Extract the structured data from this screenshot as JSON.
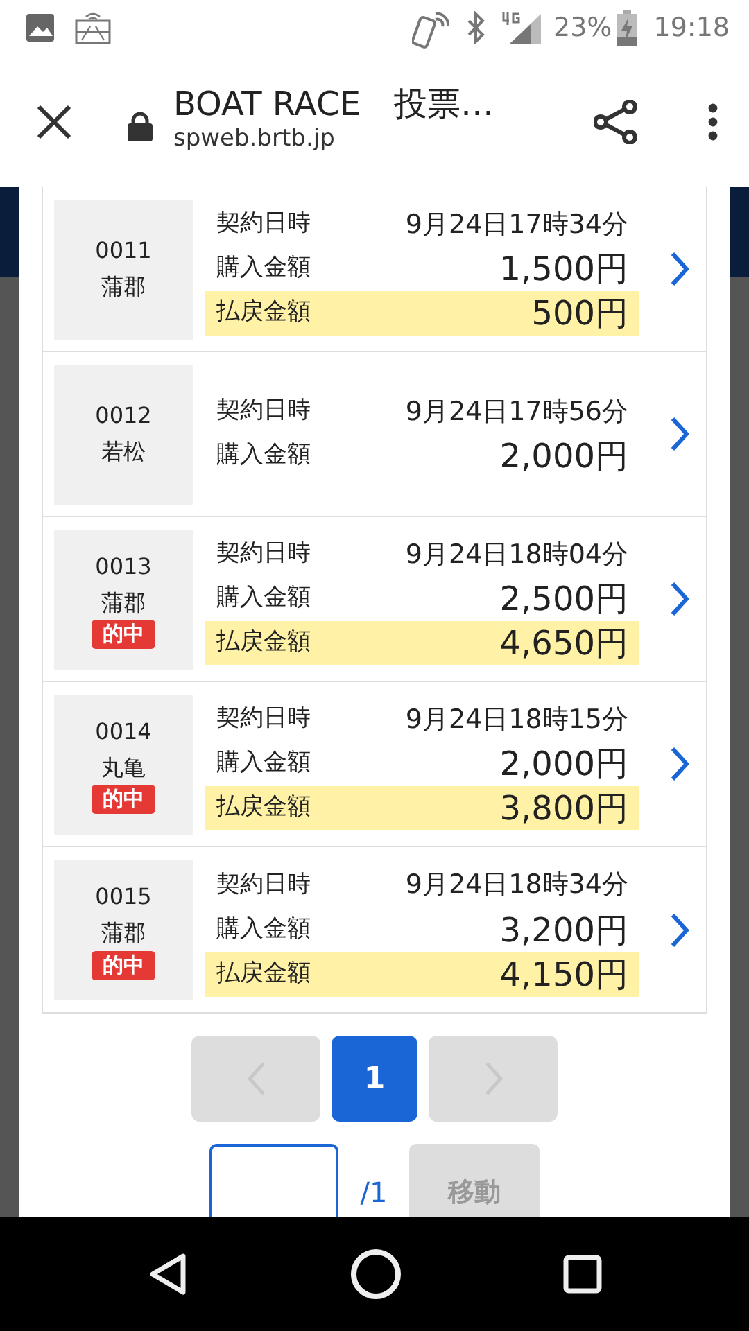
{
  "status_bar": {
    "battery": "23%",
    "time": "19:18"
  },
  "browser": {
    "title": "BOAT RACE　投票…",
    "url": "spweb.brtb.jp"
  },
  "tickets": [
    {
      "number": "0011",
      "venue": "蒲郡",
      "rows": [
        {
          "kind": "plain",
          "label": "契約日時",
          "value": "9月24日17時34分"
        },
        {
          "kind": "amount",
          "label": "購入金額",
          "value": "1,500円"
        },
        {
          "kind": "payout",
          "label": "払戻金額",
          "value": "500円"
        }
      ]
    },
    {
      "number": "0012",
      "venue": "若松",
      "rows": [
        {
          "kind": "plain",
          "label": "契約日時",
          "value": "9月24日17時56分"
        },
        {
          "kind": "amount",
          "label": "購入金額",
          "value": "2,000円"
        }
      ]
    },
    {
      "number": "0013",
      "venue": "蒲郡",
      "badge": "的中",
      "rows": [
        {
          "kind": "plain",
          "label": "契約日時",
          "value": "9月24日18時04分"
        },
        {
          "kind": "amount",
          "label": "購入金額",
          "value": "2,500円"
        },
        {
          "kind": "payout",
          "label": "払戻金額",
          "value": "4,650円"
        }
      ]
    },
    {
      "number": "0014",
      "venue": "丸亀",
      "badge": "的中",
      "rows": [
        {
          "kind": "plain",
          "label": "契約日時",
          "value": "9月24日18時15分"
        },
        {
          "kind": "amount",
          "label": "購入金額",
          "value": "2,000円"
        },
        {
          "kind": "payout",
          "label": "払戻金額",
          "value": "3,800円"
        }
      ]
    },
    {
      "number": "0015",
      "venue": "蒲郡",
      "badge": "的中",
      "rows": [
        {
          "kind": "plain",
          "label": "契約日時",
          "value": "9月24日18時34分"
        },
        {
          "kind": "amount",
          "label": "購入金額",
          "value": "3,200円"
        },
        {
          "kind": "payout",
          "label": "払戻金額",
          "value": "4,150円"
        }
      ]
    }
  ],
  "pagination": {
    "pages": [
      {
        "label": "1",
        "selected": true
      }
    ],
    "prev_disabled": true,
    "next_disabled": true
  },
  "page_jump": {
    "total": "/1",
    "button": "移動",
    "disabled": true
  }
}
